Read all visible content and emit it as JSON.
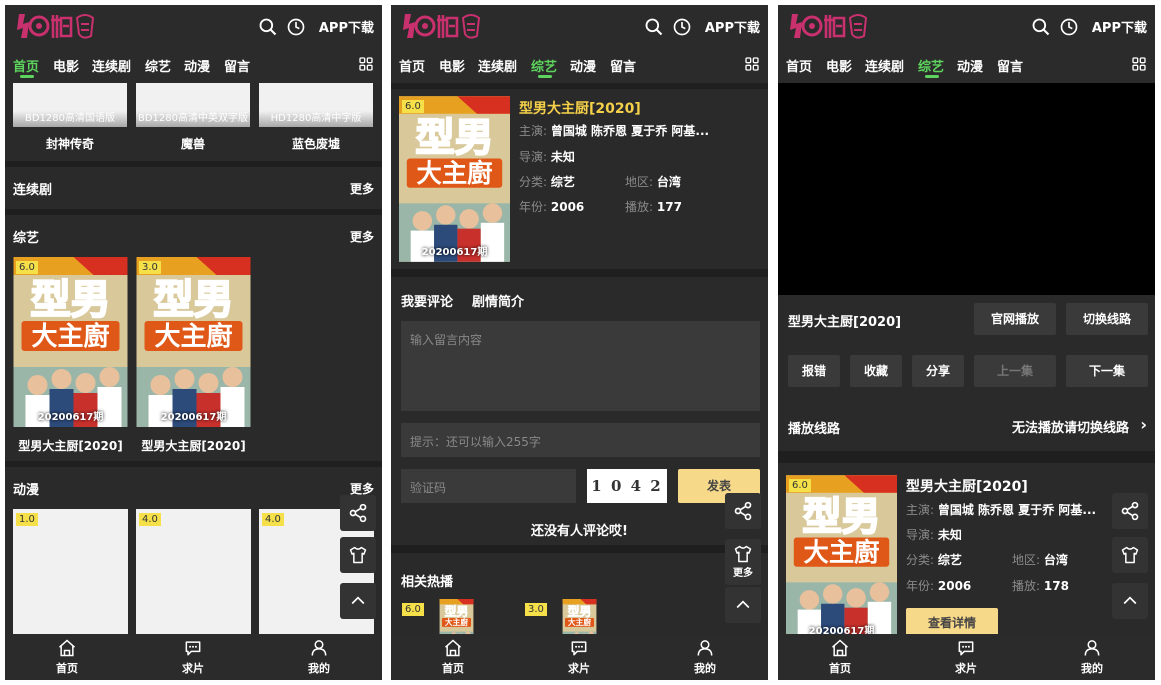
{
  "header": {
    "app_download": "APP下载"
  },
  "nav": {
    "items": [
      "首页",
      "电影",
      "连续剧",
      "综艺",
      "动漫",
      "留言"
    ]
  },
  "tabbar": {
    "items": [
      "首页",
      "求片",
      "我的"
    ]
  },
  "colors": {
    "accent_green": "#5dd45d",
    "accent_yellow": "#f5d04a",
    "logo_pink": "#c9306e"
  },
  "panel1": {
    "movies": [
      {
        "label": "BD1280高清国语版",
        "name": "封神传奇"
      },
      {
        "label": "BD1280高清中英双字版",
        "name": "魔兽"
      },
      {
        "label": "HD1280高清中字版",
        "name": "蓝色废墟"
      }
    ],
    "series_title": "连续剧",
    "series_more": "更多",
    "variety_title": "综艺",
    "variety_more": "更多",
    "variety": [
      {
        "score": "6.0",
        "episode": "20200617期",
        "name": "型男大主厨[2020]"
      },
      {
        "score": "3.0",
        "episode": "20200617期",
        "name": "型男大主厨[2020]"
      }
    ],
    "anime_title": "动漫",
    "anime_more": "更多",
    "anime_scores": [
      "1.0",
      "4.0",
      "4.0"
    ]
  },
  "panel2": {
    "score": "6.0",
    "episode": "20200617期",
    "title": "型男大主厨[2020]",
    "cast_label": "主演:",
    "cast": "曾国城 陈乔恩 夏于乔 阿基...",
    "director_label": "导演:",
    "director": "未知",
    "category_label": "分类:",
    "category": "综艺",
    "region_label": "地区:",
    "region": "台湾",
    "year_label": "年份:",
    "year": "2006",
    "plays_label": "播放:",
    "plays": "177",
    "tab_comment": "我要评论",
    "tab_synopsis": "剧情简介",
    "comment_placeholder": "输入留言内容",
    "hint": "提示：还可以输入255字",
    "captcha_placeholder": "验证码",
    "captcha": "1 0 4 2",
    "submit": "发表",
    "no_comment": "还没有人评论哎!",
    "related_title": "相关热播",
    "related_scores": [
      "6.0",
      "3.0"
    ],
    "side_more": "更多"
  },
  "panel3": {
    "title": "型男大主厨[2020]",
    "official_play": "官网播放",
    "switch_line": "切换线路",
    "report": "报错",
    "collect": "收藏",
    "share": "分享",
    "prev_ep": "上一集",
    "next_ep": "下一集",
    "lines_title": "播放线路",
    "lines_hint": "无法播放请切换线路",
    "score": "6.0",
    "episode": "20200617期",
    "info_title": "型男大主厨[2020]",
    "cast_label": "主演:",
    "cast": "曾国城 陈乔恩 夏于乔 阿基...",
    "director_label": "导演:",
    "director": "未知",
    "category_label": "分类:",
    "category": "综艺",
    "region_label": "地区:",
    "region": "台湾",
    "year_label": "年份:",
    "year": "2006",
    "plays_label": "播放:",
    "plays": "178",
    "detail_button": "查看详情"
  }
}
